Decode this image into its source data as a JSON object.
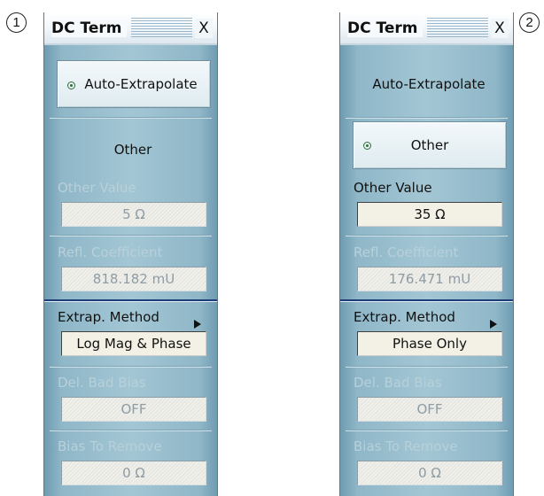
{
  "callouts": {
    "left": "1",
    "right": "2"
  },
  "left_panel": {
    "title": "DC Term",
    "close": "X",
    "auto_extrapolate": "Auto-Extrapolate",
    "other": "Other",
    "other_value_label": "Other Value",
    "other_value": "5 Ω",
    "refl_coefficient_label": "Refl. Coefficient",
    "refl_coefficient": "818.182 mU",
    "extrap_method_label": "Extrap. Method",
    "extrap_method": "Log Mag & Phase",
    "del_bad_bias_label": "Del. Bad Bias",
    "del_bad_bias": "OFF",
    "bias_to_remove_label": "Bias To Remove",
    "bias_to_remove": "0 Ω",
    "selected_mode": "Auto-Extrapolate"
  },
  "right_panel": {
    "title": "DC Term",
    "close": "X",
    "auto_extrapolate": "Auto-Extrapolate",
    "other": "Other",
    "other_value_label": "Other Value",
    "other_value": "35 Ω",
    "refl_coefficient_label": "Refl. Coefficient",
    "refl_coefficient": "176.471 mU",
    "extrap_method_label": "Extrap. Method",
    "extrap_method": "Phase Only",
    "del_bad_bias_label": "Del. Bad Bias",
    "del_bad_bias": "OFF",
    "bias_to_remove_label": "Bias To Remove",
    "bias_to_remove": "0 Ω",
    "selected_mode": "Other"
  },
  "colors": {
    "panel": "#9fc3d2",
    "disabled_text": "#b8d0da",
    "separator_accent": "#1c3d7a"
  }
}
